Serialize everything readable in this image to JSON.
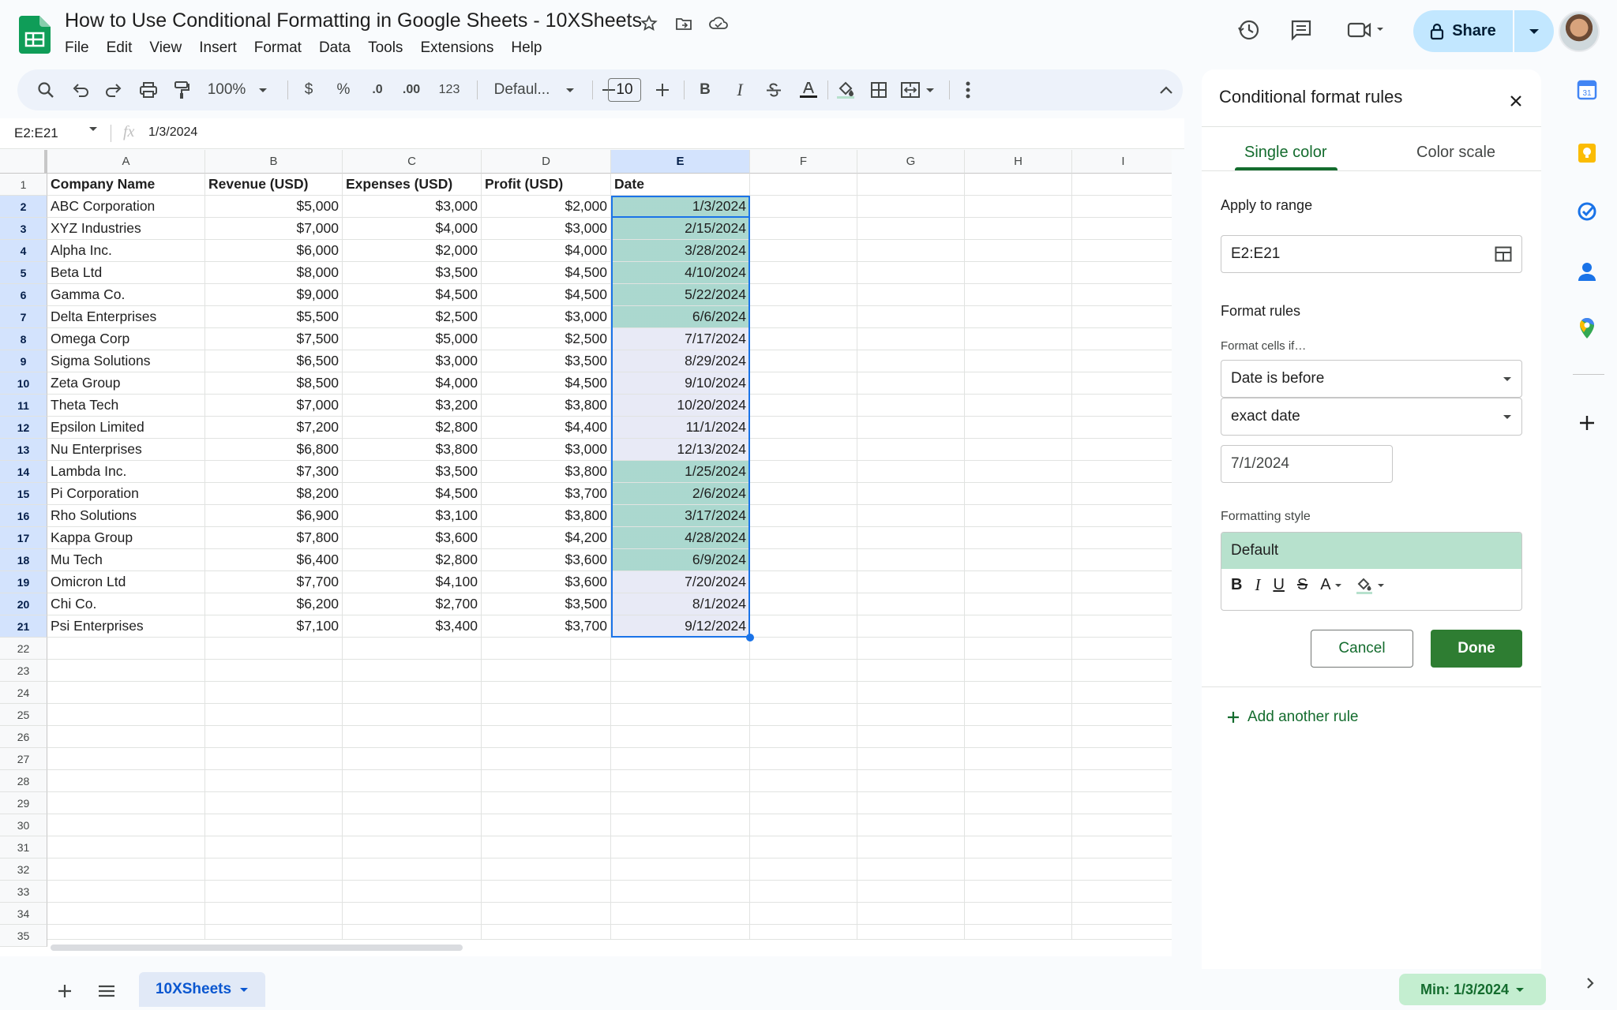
{
  "doc": {
    "title": "How to Use Conditional Formatting in Google Sheets - 10XSheets"
  },
  "menu": [
    "File",
    "Edit",
    "View",
    "Insert",
    "Format",
    "Data",
    "Tools",
    "Extensions",
    "Help"
  ],
  "share": {
    "label": "Share"
  },
  "toolbar": {
    "zoom": "100%",
    "currency": "$",
    "percent": "%",
    "decrease_decimal": ".0",
    "increase_decimal": ".00",
    "number_format": "123",
    "font": "Defaul...",
    "font_size": "10",
    "bold": "B",
    "italic": "I"
  },
  "formula_bar": {
    "name_box": "E2:E21",
    "fx": "fx",
    "value": "1/3/2024"
  },
  "grid": {
    "columns": [
      "A",
      "B",
      "C",
      "D",
      "E",
      "F",
      "G",
      "H",
      "I"
    ],
    "row_numbers": [
      "1",
      "2",
      "3",
      "4",
      "5",
      "6",
      "7",
      "8",
      "9",
      "10",
      "11",
      "12",
      "13",
      "14",
      "15",
      "16",
      "17",
      "18",
      "19",
      "20",
      "21",
      "22",
      "23",
      "24",
      "25",
      "26",
      "27",
      "28",
      "29",
      "30",
      "31",
      "32",
      "33",
      "34",
      "35"
    ],
    "headers": [
      "Company Name",
      "Revenue (USD)",
      "Expenses (USD)",
      "Profit (USD)",
      "Date"
    ],
    "rows": [
      [
        "ABC Corporation",
        "$5,000",
        "$3,000",
        "$2,000",
        "1/3/2024"
      ],
      [
        "XYZ Industries",
        "$7,000",
        "$4,000",
        "$3,000",
        "2/15/2024"
      ],
      [
        "Alpha Inc.",
        "$6,000",
        "$2,000",
        "$4,000",
        "3/28/2024"
      ],
      [
        "Beta Ltd",
        "$8,000",
        "$3,500",
        "$4,500",
        "4/10/2024"
      ],
      [
        "Gamma Co.",
        "$9,000",
        "$4,500",
        "$4,500",
        "5/22/2024"
      ],
      [
        "Delta Enterprises",
        "$5,500",
        "$2,500",
        "$3,000",
        "6/6/2024"
      ],
      [
        "Omega Corp",
        "$7,500",
        "$5,000",
        "$2,500",
        "7/17/2024"
      ],
      [
        "Sigma Solutions",
        "$6,500",
        "$3,000",
        "$3,500",
        "8/29/2024"
      ],
      [
        "Zeta Group",
        "$8,500",
        "$4,000",
        "$4,500",
        "9/10/2024"
      ],
      [
        "Theta Tech",
        "$7,000",
        "$3,200",
        "$3,800",
        "10/20/2024"
      ],
      [
        "Epsilon Limited",
        "$7,200",
        "$2,800",
        "$4,400",
        "11/1/2024"
      ],
      [
        "Nu Enterprises",
        "$6,800",
        "$3,800",
        "$3,000",
        "12/13/2024"
      ],
      [
        "Lambda Inc.",
        "$7,300",
        "$3,500",
        "$3,800",
        "1/25/2024"
      ],
      [
        "Pi Corporation",
        "$8,200",
        "$4,500",
        "$3,700",
        "2/6/2024"
      ],
      [
        "Rho Solutions",
        "$6,900",
        "$3,100",
        "$3,800",
        "3/17/2024"
      ],
      [
        "Kappa Group",
        "$7,800",
        "$3,600",
        "$4,200",
        "4/28/2024"
      ],
      [
        "Mu Tech",
        "$6,400",
        "$2,800",
        "$3,600",
        "6/9/2024"
      ],
      [
        "Omicron Ltd",
        "$7,700",
        "$4,100",
        "$3,600",
        "7/20/2024"
      ],
      [
        "Chi Co.",
        "$6,200",
        "$2,700",
        "$3,500",
        "8/1/2024"
      ],
      [
        "Psi Enterprises",
        "$7,100",
        "$3,400",
        "$3,700",
        "9/12/2024"
      ]
    ],
    "highlighted_rows": [
      true,
      true,
      true,
      true,
      true,
      true,
      false,
      false,
      false,
      false,
      false,
      false,
      true,
      true,
      true,
      true,
      true,
      false,
      false,
      false
    ]
  },
  "colors": {
    "highlight_fill": "#b7e1cd",
    "selection_fill": "#e8eaf6",
    "selection_border": "#1a73e8",
    "done_button": "#2e7d32"
  },
  "panel": {
    "title": "Conditional format rules",
    "tabs": [
      "Single color",
      "Color scale"
    ],
    "apply_to_range_label": "Apply to range",
    "range": "E2:E21",
    "format_rules_label": "Format rules",
    "format_cells_if_label": "Format cells if…",
    "condition": "Date is before",
    "date_option": "exact date",
    "date_value": "7/1/2024",
    "formatting_style_label": "Formatting style",
    "style_preview": "Default",
    "cancel": "Cancel",
    "done": "Done",
    "add_rule": "Add another rule"
  },
  "sheet": {
    "tab": "10XSheets",
    "summary": "Min: 1/3/2024"
  }
}
